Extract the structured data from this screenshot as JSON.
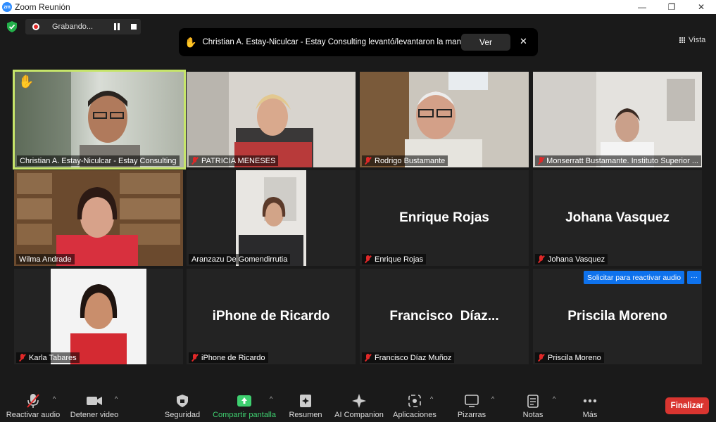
{
  "window": {
    "title": "Zoom Reunión",
    "logo_text": "zm",
    "minimize": "—",
    "maximize": "❐",
    "close": "✕"
  },
  "recording": {
    "label": "Grabando..."
  },
  "notification": {
    "hand": "✋",
    "text": "Christian A. Estay-Niculcar - Estay Consulting levantó/levantaron la mano",
    "view_label": "Ver",
    "close": "✕"
  },
  "view": {
    "label": "Vista"
  },
  "tiles": [
    {
      "name": "Christian A. Estay-Niculcar - Estay Consulting",
      "video": true,
      "muted": false,
      "hand": "✋"
    },
    {
      "name": "PATRICIA MENESES",
      "video": true,
      "muted": true
    },
    {
      "name": "Rodrigo Bustamante",
      "video": true,
      "muted": true
    },
    {
      "name": "Monserratt Bustamante. Instituto Superior ...",
      "video": true,
      "muted": true
    },
    {
      "name": "Wilma Andrade",
      "video": true,
      "muted": false
    },
    {
      "name": "Aranzazu De Gomendirrutia",
      "video": true,
      "muted": false
    },
    {
      "name": "Enrique Rojas",
      "display": "Enrique Rojas",
      "video": false,
      "muted": true
    },
    {
      "name": "Johana Vasquez",
      "display": "Johana Vasquez",
      "video": false,
      "muted": true
    },
    {
      "name": "Karla Tabares",
      "video": true,
      "muted": true
    },
    {
      "name": "iPhone de Ricardo",
      "display": "iPhone de Ricardo",
      "video": false,
      "muted": true
    },
    {
      "name": "Francisco Díaz Muñoz",
      "display": "Francisco  Díaz...",
      "video": false,
      "muted": true
    },
    {
      "name": "Priscila Moreno",
      "display": "Priscila Moreno",
      "video": false,
      "muted": true,
      "request_audio": "Solicitar para reactivar audio",
      "more": "···"
    }
  ],
  "toolbar": {
    "unmute": "Reactivar audio",
    "stop_video": "Detener video",
    "security": "Seguridad",
    "share": "Compartir pantalla",
    "summary": "Resumen",
    "ai": "AI Companion",
    "apps": "Aplicaciones",
    "whiteboards": "Pizarras",
    "notes": "Notas",
    "more": "Más",
    "end": "Finalizar",
    "caret": "^"
  },
  "colors": {
    "active_speaker": "#c6e56a",
    "share_green": "#3ed070",
    "end_red": "#d93530",
    "request_blue": "#0e72ed"
  }
}
